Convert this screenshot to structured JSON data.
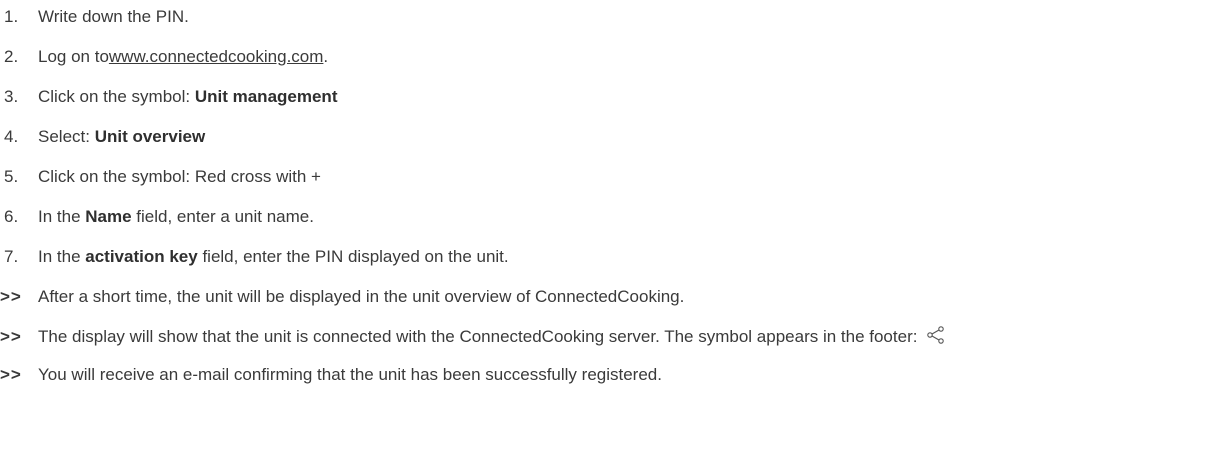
{
  "steps": [
    {
      "marker": "1.",
      "parts": [
        "Write down the PIN."
      ]
    },
    {
      "marker": "2.",
      "before": "Log on to",
      "link": "www.connectedcooking.com",
      "after": "."
    },
    {
      "marker": "3.",
      "before": "Click on the symbol: ",
      "bold": "Unit management"
    },
    {
      "marker": "4.",
      "before": "Select: ",
      "bold": "Unit overview"
    },
    {
      "marker": "5.",
      "before": "Click on the symbol: Red cross with +"
    },
    {
      "marker": "6.",
      "before": "In the ",
      "bold": "Name",
      "after": " field, enter a unit name."
    },
    {
      "marker": "7.",
      "before": "In the ",
      "bold": "activation key",
      "after": " field, enter the PIN displayed on the unit."
    }
  ],
  "results": [
    {
      "marker": ">>",
      "text": "After a short time, the unit will be displayed in the unit overview of ConnectedCooking."
    },
    {
      "marker": ">>",
      "text": "The display will show that the unit is connected with the ConnectedCooking server. The symbol appears in the footer: ",
      "icon": "share-icon"
    },
    {
      "marker": ">>",
      "text": "You will receive an e-mail confirming that the unit has been successfully registered."
    }
  ]
}
